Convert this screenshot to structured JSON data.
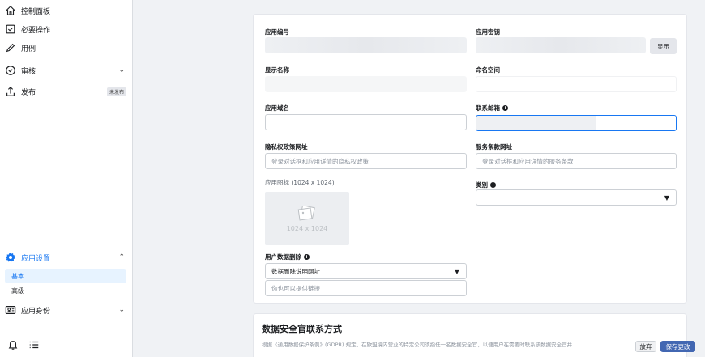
{
  "sidebar": {
    "items": [
      {
        "label": "控制面板",
        "icon": "home-icon"
      },
      {
        "label": "必要操作",
        "icon": "checklist-icon"
      },
      {
        "label": "用例",
        "icon": "pencil-icon"
      },
      {
        "label": "审核",
        "icon": "shield-check-icon"
      },
      {
        "label": "发布",
        "icon": "upload-icon",
        "badge": "未发布"
      }
    ],
    "app_settings": {
      "label": "应用设置",
      "sub": [
        "基本",
        "高级"
      ]
    },
    "app_roles": {
      "label": "应用身份"
    },
    "chevron_down": "⌄",
    "chevron_up": "⌃"
  },
  "form": {
    "app_id_label": "应用编号",
    "app_secret_label": "应用密钥",
    "show_button": "显示",
    "display_name_label": "显示名称",
    "namespace_label": "命名空间",
    "app_domain_label": "应用域名",
    "contact_email_label": "联系邮箱",
    "privacy_label": "隐私权政策网址",
    "privacy_placeholder": "登录对话框和应用详情的隐私权政策",
    "tos_label": "服务条款网址",
    "tos_placeholder": "登录对话框和应用详情的服务条款",
    "app_icon_label": "应用图标 (1024 x 1024)",
    "app_icon_size": "1024 x 1024",
    "category_label": "类别",
    "data_deletion_label": "用户数据删除",
    "data_deletion_select": "数据删除说明网址",
    "data_deletion_placeholder": "你也可以提供链接",
    "info_glyph": "i",
    "caret": "▼"
  },
  "dpo": {
    "title": "数据安全官联系方式",
    "desc": "根据《通用数据保护条例》(GDPR) 规定，在欧盟境内营业的特定公司须指任一名数据安全官，以便用户在需要时联系该数据安全官并"
  },
  "footer": {
    "discard": "放弃",
    "save": "保存更改"
  },
  "colors": {
    "accent": "#1877f2",
    "save_button": "#4267b2"
  }
}
